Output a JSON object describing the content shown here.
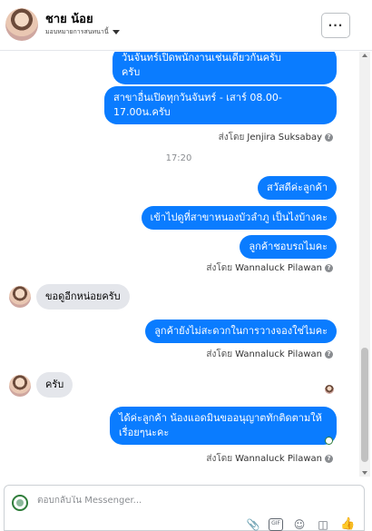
{
  "header": {
    "name": "ชาย น้อย",
    "assign_label": "มอบหมายการสนทนานี้",
    "more_label": "···"
  },
  "messages": {
    "m1_line1": "วันจันทร์เปิดพนักงานเช่นเดียวกันครับ",
    "m1_line2": "ครับ",
    "m2_line1": "สาขาอื่นเปิดทุกวันจันทร์ - เสาร์ 08.00-",
    "m2_line2": "17.00น.ครับ",
    "sent1_label": "ส่งโดย",
    "sent1_name": "Jenjira Suksabay",
    "time": "17:20",
    "m3": "สวัสดีค่ะลูกค้า",
    "m4": "เข้าไปดูที่สาขาหนองบัวลำภู เป็นไงบ้างคะ",
    "m5": "ลูกค้าชอบรถไมคะ",
    "sent2_label": "ส่งโดย",
    "sent2_name": "Wannaluck Pilawan",
    "in1": "ขอดูอีกหน่อยครับ",
    "m6": "ลูกค้ายังไม่สะดวกในการวางจองใช่ไมคะ",
    "sent3_label": "ส่งโดย",
    "sent3_name": "Wannaluck Pilawan",
    "in2": "ครับ",
    "m7_line1": "ได้ค่ะลูกค้า น้องแอดมินขออนุญาตทักติดตามให้",
    "m7_line2": "เรื่อยๆนะคะ",
    "sent4_label": "ส่งโดย",
    "sent4_name": "Wannaluck Pilawan",
    "help": "?"
  },
  "composer": {
    "placeholder": "ตอบกลับใน Messenger..."
  },
  "icons": {
    "attach": "paperclip-icon",
    "gif": "gif-icon",
    "emoji": "emoji-icon",
    "sticker": "sticker-icon",
    "like": "thumbs-up-icon"
  },
  "colors": {
    "outgoing_bubble": "#0a7cff",
    "incoming_bubble": "#e4e6eb",
    "like": "#0a7cff"
  }
}
